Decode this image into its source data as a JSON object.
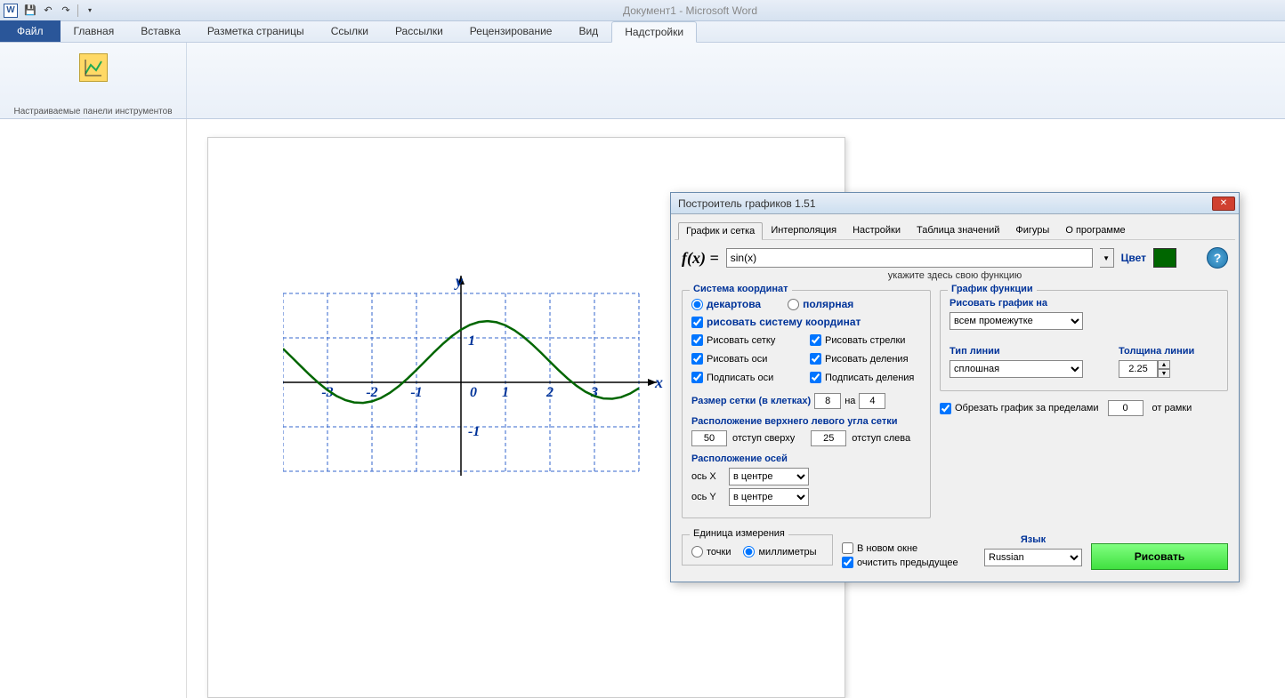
{
  "app": {
    "title": "Документ1  -  Microsoft Word"
  },
  "ribbon": {
    "file": "Файл",
    "tabs": [
      "Главная",
      "Вставка",
      "Разметка страницы",
      "Ссылки",
      "Рассылки",
      "Рецензирование",
      "Вид",
      "Надстройки"
    ],
    "group_label": "Настраиваемые панели инструментов"
  },
  "dialog": {
    "title": "Построитель графиков 1.51",
    "tabs": [
      "График и сетка",
      "Интерполяция",
      "Настройки",
      "Таблица значений",
      "Фигуры",
      "О программе"
    ],
    "fx_label": "f(x) =",
    "fx_value": "sin(x)",
    "color_label": "Цвет",
    "color_value": "#006600",
    "hint": "укажите здесь свою функцию",
    "coord_legend": "Система координат",
    "radio_dec": "декартова",
    "radio_pol": "полярная",
    "draw_system": "рисовать систему координат",
    "draw_grid": "Рисовать сетку",
    "draw_arrows": "Рисовать стрелки",
    "draw_axes": "Рисовать оси",
    "draw_ticks": "Рисовать деления",
    "label_axes": "Подписать оси",
    "label_ticks": "Подписать деления",
    "grid_size_label": "Размер сетки (в клетках)",
    "grid_w": "8",
    "grid_by": "на",
    "grid_h": "4",
    "pos_legend": "Расположение верхнего левого угла сетки",
    "top_off": "50",
    "top_lbl": "отступ сверху",
    "left_off": "25",
    "left_lbl": "отступ слева",
    "axes_pos_legend": "Расположение осей",
    "axis_x_lbl": "ось X",
    "axis_y_lbl": "ось Y",
    "axis_center": "в центре",
    "func_legend": "График функции",
    "draw_on_lbl": "Рисовать график на",
    "draw_on_val": "всем промежутке",
    "line_type_lbl": "Тип линии",
    "line_type_val": "сплошная",
    "thickness_lbl": "Толщина линии",
    "thickness_val": "2.25",
    "clip_lbl": "Обрезать график за пределами",
    "clip_val": "0",
    "clip_unit": "от рамки",
    "unit_legend": "Единица измерения",
    "unit_points": "точки",
    "unit_mm": "миллиметры",
    "new_window": "В новом окне",
    "clear_prev": "очистить предыдущее",
    "lang_lbl": "Язык",
    "lang_val": "Russian",
    "draw_btn": "Рисовать"
  },
  "chart_data": {
    "type": "line",
    "function": "sin(x)",
    "x_range": [
      -4,
      4
    ],
    "y_range": [
      -2,
      2
    ],
    "x_ticks": [
      -3,
      -2,
      -1,
      0,
      1,
      2,
      3
    ],
    "xlabel": "x",
    "ylabel": "y",
    "ytick_labels": [
      "1",
      "-1"
    ],
    "grid_cells": [
      8,
      4
    ],
    "line_color": "#006600",
    "line_width": 2.25,
    "series": [
      {
        "name": "sin(x)",
        "desc": "y = sin(x) over [-4,4]"
      }
    ]
  }
}
